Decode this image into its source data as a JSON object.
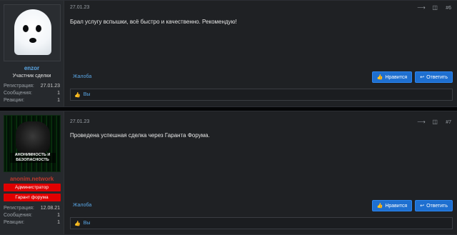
{
  "posts": [
    {
      "user": {
        "name": "enzor",
        "title": "Участник сделки",
        "banners": [],
        "stats": [
          {
            "label": "Регистрация:",
            "value": "27.01.23"
          },
          {
            "label": "Сообщения:",
            "value": "1"
          },
          {
            "label": "Реакции:",
            "value": "1"
          }
        ],
        "avatar": "ghost-avatar"
      },
      "date": "27.01.23",
      "number": "#6",
      "message": "Брал услугу вспышки, всё быстро и качественно. Рекомендую!",
      "report_label": "Жалоба",
      "like_label": "Нравится",
      "reply_label": "Ответить",
      "reaction_text": "Вы"
    },
    {
      "user": {
        "name": "anonim.network",
        "title": "",
        "banners": [
          "Администратор",
          "Гарант форума"
        ],
        "stats": [
          {
            "label": "Регистрация:",
            "value": "12.08.21"
          },
          {
            "label": "Сообщения:",
            "value": "1"
          },
          {
            "label": "Реакции:",
            "value": "1"
          }
        ],
        "avatar": "anonymous-hacker-avatar",
        "avatar_text": "АНОНИМНОСТЬ И БЕЗОПАСНОСТЬ"
      },
      "date": "27.01.23",
      "number": "#7",
      "message": "Проведена успешная сделка через Гаранта Форума.",
      "report_label": "Жалоба",
      "like_label": "Нравится",
      "reply_label": "Ответить",
      "reaction_text": "Вы"
    }
  ],
  "icons": {
    "share": "share-icon",
    "bookmark": "bookmark-icon",
    "like": "thumbs-up-icon",
    "reply": "reply-icon"
  },
  "colors": {
    "accent": "#1e6fd0",
    "link": "#5aa7e6",
    "admin_banner": "#e00000",
    "admin_name": "#c0392b"
  }
}
